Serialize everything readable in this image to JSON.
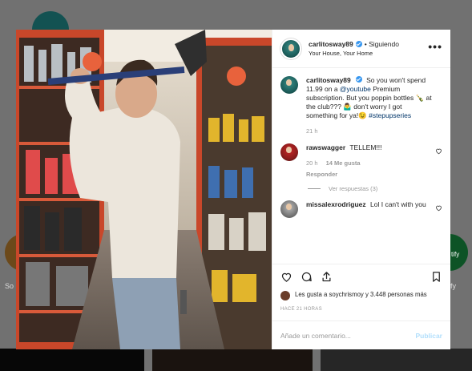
{
  "background": {
    "left_label": "So",
    "right_label": "fy",
    "right_circle_text": "tify"
  },
  "post": {
    "username": "carlitosway89",
    "follow_separator": "•",
    "follow_label": "Siguiendo",
    "subtitle": "Your House, Your Home",
    "more_label": "•••",
    "caption": {
      "username": "carlitosway89",
      "text_1": "So you won't spend 11.99 on a",
      "mention": "@youtube",
      "text_2": "Premium subscription. But you poppin bottles 🍾 at the club??? 🤷‍♂️ don't worry I got something for ya!😉",
      "hashtag": "#stepupseries",
      "time": "21 h"
    },
    "comments": [
      {
        "username": "rawswagger",
        "text": "TELLEM!!!",
        "time": "20 h",
        "likes": "14 Me gusta",
        "reply": "Responder"
      },
      {
        "username": "missalexrodriguez",
        "text": "Lol I can't with you"
      }
    ],
    "view_replies": "Ver respuestas (3)",
    "likes_text": "Les gusta a soychrismoy y 3.448 personas más",
    "likes_user": "soychrismoy",
    "time_ago": "HACE 21 HORAS",
    "add_comment_placeholder": "Añade un comentario...",
    "publish_label": "Publicar"
  },
  "icons": [
    "heart-icon",
    "comment-icon",
    "share-icon",
    "bookmark-icon",
    "verified-icon",
    "more-options-icon"
  ],
  "colors": {
    "link": "#003569",
    "verified": "#3897f0",
    "muted": "#999999",
    "publish_disabled": "#b2dffc"
  }
}
